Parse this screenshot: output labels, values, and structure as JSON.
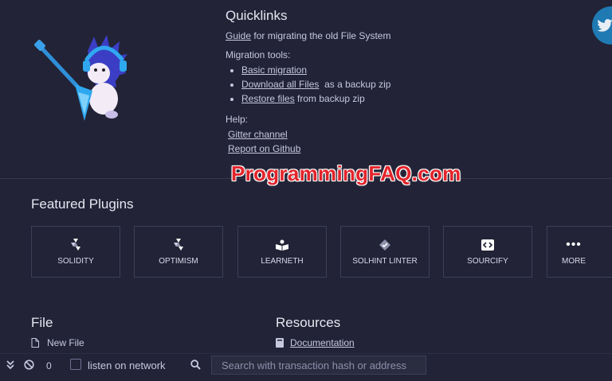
{
  "quicklinks": {
    "title": "Quicklinks",
    "guide_link": "Guide",
    "guide_text": "for migrating the old File System",
    "migration_heading": "Migration tools:",
    "migration_items": [
      {
        "link": "Basic migration",
        "suffix": ""
      },
      {
        "link": "Download all Files",
        "suffix": "as a backup zip"
      },
      {
        "link": "Restore files",
        "suffix": "from backup zip"
      }
    ],
    "help_heading": "Help:",
    "help_links": [
      "Gitter channel",
      "Report on Github"
    ]
  },
  "watermark": "ProgrammingFAQ.com",
  "featured": {
    "title": "Featured Plugins",
    "plugins": [
      {
        "label": "SOLIDITY",
        "icon": "solidity-icon"
      },
      {
        "label": "OPTIMISM",
        "icon": "optimism-icon"
      },
      {
        "label": "LEARNETH",
        "icon": "book-icon"
      },
      {
        "label": "SOLHINT LINTER",
        "icon": "solhint-icon"
      },
      {
        "label": "SOURCIFY",
        "icon": "sourcify-icon"
      },
      {
        "label": "MORE",
        "icon": "more-icon"
      }
    ]
  },
  "file_section": {
    "title": "File",
    "new_file": "New File"
  },
  "resources": {
    "title": "Resources",
    "documentation": "Documentation"
  },
  "terminal": {
    "count": "0",
    "listen_label": "listen on network",
    "listen_checked": false,
    "search_placeholder": "Search with transaction hash or address"
  },
  "colors": {
    "background": "#222336",
    "text": "#c6c8de",
    "twitter": "#1f7ab3",
    "watermark": "#e3242b"
  }
}
